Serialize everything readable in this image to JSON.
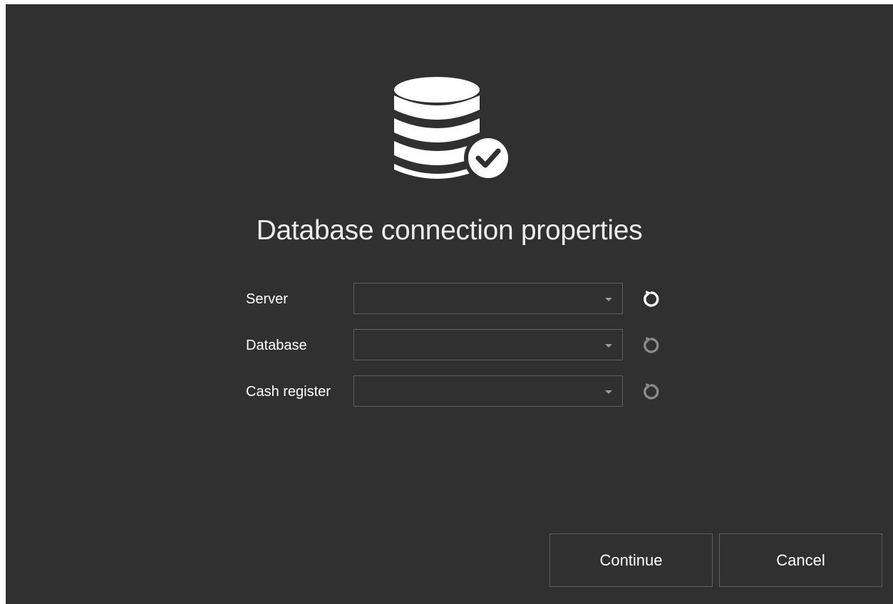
{
  "dialog": {
    "title": "Database connection properties",
    "icon": "database-check-icon"
  },
  "fields": [
    {
      "label": "Server",
      "value": "",
      "refresh_enabled": true
    },
    {
      "label": "Database",
      "value": "",
      "refresh_enabled": false
    },
    {
      "label": "Cash register",
      "value": "",
      "refresh_enabled": false
    }
  ],
  "buttons": {
    "continue_label": "Continue",
    "cancel_label": "Cancel"
  },
  "colors": {
    "background": "#303030",
    "border": "#5e5e5e",
    "text": "#ffffff",
    "icon_disabled": "#8a8a8a"
  }
}
